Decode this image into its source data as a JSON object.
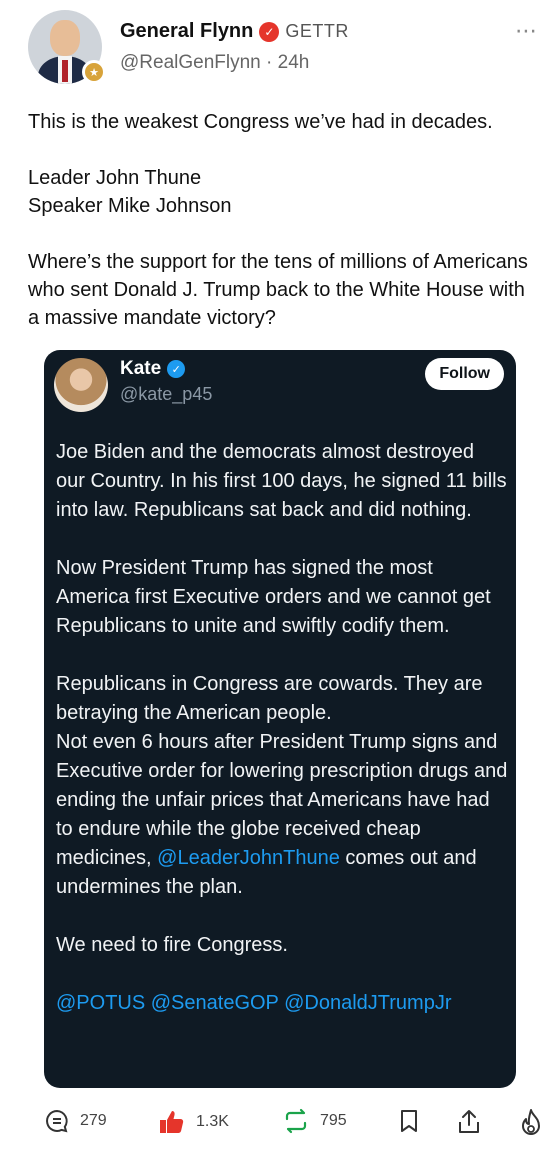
{
  "post": {
    "author": {
      "display_name": "General Flynn",
      "network_label": "GETTR",
      "handle": "@RealGenFlynn",
      "time": "· 24h"
    },
    "more_icon": "⋯",
    "paragraphs": [
      "This is the weakest Congress we’ve had in decades.",
      "Leader John Thune\nSpeaker Mike Johnson",
      "Where’s the support for the tens of millions of Americans who sent Donald J. Trump back to the White House with a massive mandate victory?"
    ]
  },
  "quote": {
    "author": {
      "display_name": "Kate",
      "handle": "@kate_p45"
    },
    "follow_label": "Follow",
    "p1": "Joe Biden and the democrats almost destroyed our Country. In his first 100 days, he signed 11 bills into law. Republicans sat back and did nothing.",
    "p2": "Now President Trump has signed the most America first Executive orders and we cannot get Republicans to unite and swiftly codify them.",
    "p3a": "Republicans in Congress are cowards. They are betraying the American people.",
    "p3b_before": "Not even 6 hours after President Trump signs and Executive order for lowering prescription drugs and ending the unfair prices that Americans have had to endure while the globe received cheap medicines, ",
    "p3b_mention": "@LeaderJohnThune",
    "p3b_after": " comes out and undermines the plan.",
    "p4": "We need to fire Congress.",
    "p5": "@POTUS @SenateGOP @DonaldJTrumpJr"
  },
  "actions": {
    "comments": "279",
    "likes": "1.3K",
    "reposts": "795"
  },
  "icons": {
    "comment": "comment-icon",
    "like": "thumbs-up-icon",
    "repost": "repost-icon",
    "bookmark": "bookmark-icon",
    "share": "share-icon",
    "boost": "fire-icon"
  },
  "colors": {
    "accent_red": "#e5352b",
    "link_blue": "#1d9bf0",
    "card_bg": "#0f1a24"
  }
}
